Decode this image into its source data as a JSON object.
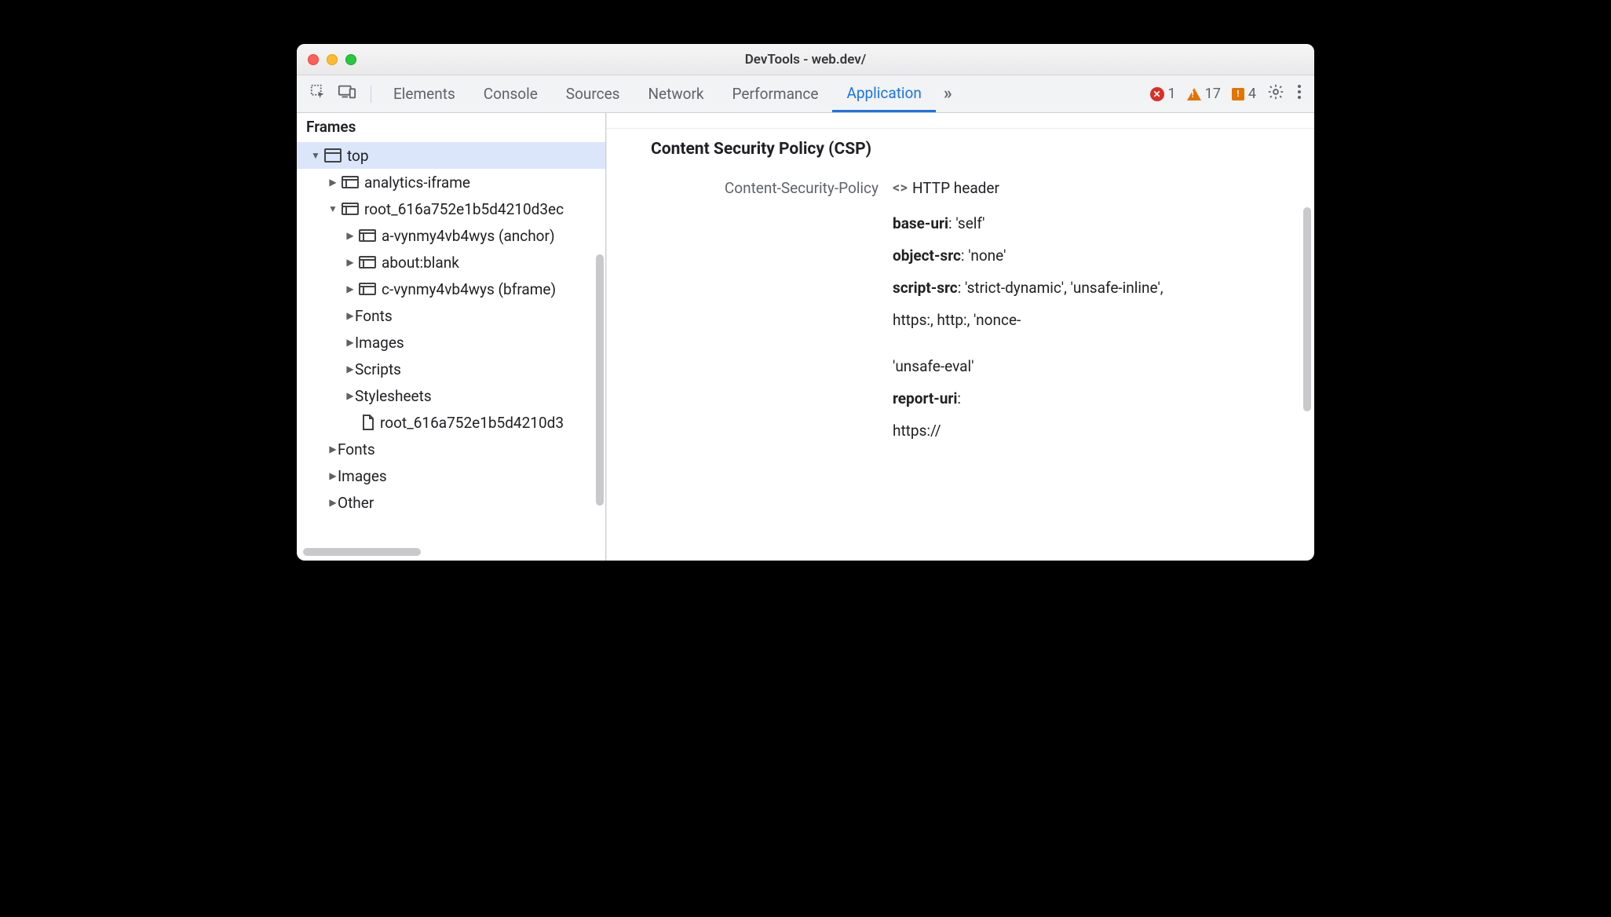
{
  "window": {
    "title": "DevTools - web.dev/"
  },
  "toolbar": {
    "tabs": [
      "Elements",
      "Console",
      "Sources",
      "Network",
      "Performance",
      "Application"
    ],
    "active_tab_index": 5,
    "counts": {
      "errors": "1",
      "warnings": "17",
      "info": "4"
    }
  },
  "sidebar": {
    "section_title": "Frames",
    "tree": {
      "top_label": "top",
      "root_frame_label": "root_616a752e1b5d4210d3ec",
      "children": [
        "a-vynmy4vb4wys (anchor)",
        "about:blank",
        "c-vynmy4vb4wys (bframe)"
      ],
      "folders_inner": [
        "Fonts",
        "Images",
        "Scripts",
        "Stylesheets"
      ],
      "file_label": "root_616a752e1b5d4210d3",
      "folders_outer": [
        "Fonts",
        "Images",
        "Other"
      ]
    }
  },
  "main": {
    "csp": {
      "title": "Content Security Policy (CSP)",
      "header_key": "Content-Security-Policy",
      "header_val": "HTTP header",
      "directives": [
        {
          "key": "base-uri",
          "val": ": 'self'"
        },
        {
          "key": "object-src",
          "val": ": 'none'"
        },
        {
          "key": "script-src",
          "val": ": 'strict-dynamic', 'unsafe-inline',"
        },
        {
          "key": "",
          "val": "https:, http:, 'nonce-"
        },
        {
          "key": "",
          "val": ""
        },
        {
          "key": "",
          "val": "'unsafe-eval'"
        },
        {
          "key": "report-uri",
          "val": ":"
        },
        {
          "key": "",
          "val": "https://"
        }
      ]
    }
  }
}
